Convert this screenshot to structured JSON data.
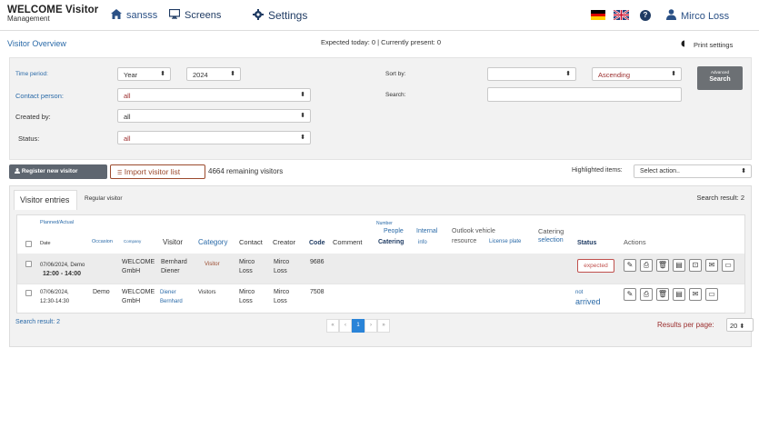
{
  "brand": {
    "title": "WELCOME Visitor",
    "subtitle": "Management"
  },
  "nav": {
    "home": "sansss",
    "screens": "Screens",
    "settings": "Settings"
  },
  "header": {
    "user": "Mirco Loss",
    "help": "?"
  },
  "subheader": {
    "title": "Visitor Overview",
    "counts": "Expected today: 0 | Currently present: 0",
    "print": "Print settings"
  },
  "filters": {
    "time_period_label": "Time period:",
    "time_period_value": "Year",
    "year_value": "2024",
    "contact_person_label": "Contact person:",
    "contact_person_value": "all",
    "created_by_label": "Created by:",
    "created_by_value": "all",
    "status_label": "Status:",
    "status_value": "all",
    "sort_by_label": "Sort by:",
    "sort_by_value": "",
    "sort_order_value": "Ascending",
    "search_label": "Search:",
    "search_value": "",
    "advanced_btn_top": "Advanced",
    "advanced_btn_bottom": "Search"
  },
  "actions": {
    "register_btn": "Register new visitor",
    "import_btn": "Import visitor list",
    "remaining": "4664 remaining visitors",
    "highlighted_label": "Highlighted items:",
    "highlighted_value": "Select action.."
  },
  "tabs": {
    "entries": "Visitor entries",
    "regular": "Regular visitor"
  },
  "search_result": "Search result: 2",
  "table": {
    "headers": {
      "planned": "Planned/Actual",
      "date": "Date",
      "occasion": "Occasion",
      "company": "Company",
      "visitor": "Visitor",
      "category": "Category",
      "contact": "Contact",
      "creator": "Creator",
      "code": "Code",
      "comment": "Comment",
      "number": "Number",
      "people": "People",
      "catering": "Catering",
      "internal": "Internal",
      "info": "info",
      "outlook": "Outlook vehicle",
      "resource": "resource",
      "license": "License plate",
      "catering2": "Catering",
      "selection": "selection",
      "status": "Status",
      "actions": "Actions"
    },
    "rows": [
      {
        "date": "07/06/2024,",
        "time": "12:00 - 14:00",
        "occasion": "Demo",
        "company1": "WELCOME",
        "company2": "GmbH",
        "visitor1": "Bernhard",
        "visitor2": "Diener",
        "category": "Visitor",
        "contact1": "Mirco",
        "contact2": "Loss",
        "creator1": "Mirco",
        "creator2": "Loss",
        "code": "9686",
        "status": "expected"
      },
      {
        "date": "07/06/2024,",
        "time": "12:30-14:30",
        "occasion": "Demo",
        "company1": "WELCOME",
        "company2": "GmbH",
        "visitor1": "Diener",
        "visitor2": "Bernhard",
        "category": "Visitors",
        "contact1": "Mirco",
        "contact2": "Loss",
        "creator1": "Mirco",
        "creator2": "Loss",
        "code": "7508",
        "status1": "not",
        "status2": "arrived"
      }
    ]
  },
  "footer": {
    "search_result": "Search result: 2",
    "pager": [
      "«",
      "‹",
      "1",
      "›",
      "»"
    ],
    "rpp_label": "Results per page:",
    "rpp_value": "20"
  },
  "colors": {
    "accent": "#2a6aa8",
    "nav": "#1f3b63",
    "badge": "#c0504d",
    "button_dark": "#5e6670"
  }
}
